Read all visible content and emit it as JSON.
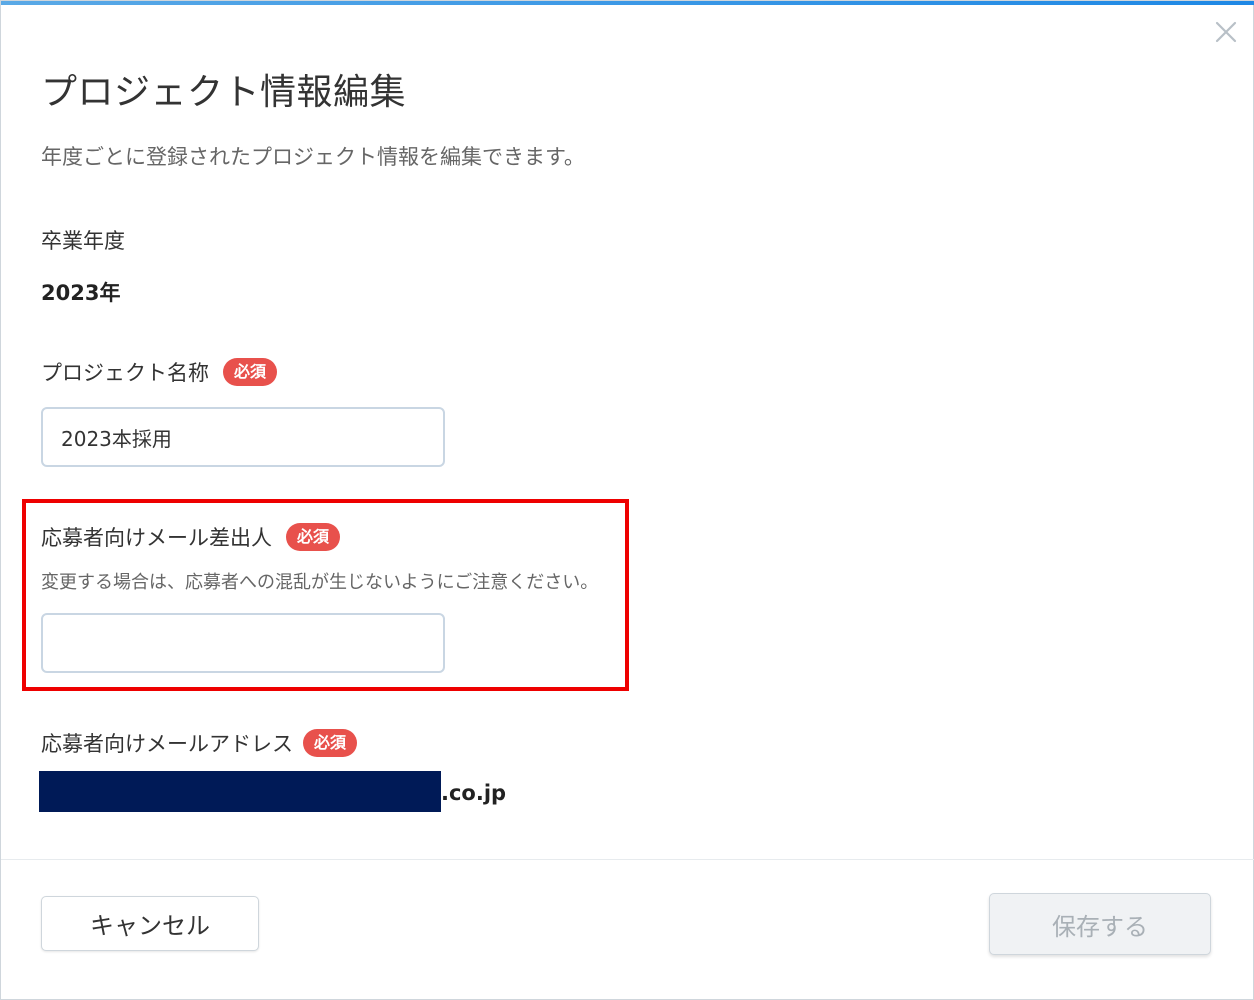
{
  "dialog": {
    "title": "プロジェクト情報編集",
    "description": "年度ごとに登録されたプロジェクト情報を編集できます。",
    "accent_color": "#1e88e5",
    "close_icon": "close-icon"
  },
  "required_badge": {
    "label": "必須",
    "color": "#e8514c"
  },
  "graduation_year": {
    "label": "卒業年度",
    "value": "2023年"
  },
  "project_name": {
    "label": "プロジェクト名称",
    "value": "2023本採用",
    "placeholder": ""
  },
  "sender_name": {
    "label": "応募者向けメール差出人",
    "hint": "変更する場合は、応募者への混乱が生じないようにご注意ください。",
    "value": "",
    "placeholder": ""
  },
  "sender_email": {
    "label": "応募者向けメールアドレス",
    "domain_suffix": ".co.jp",
    "redaction_color": "#001a57"
  },
  "highlight_color": "#ee0000",
  "buttons": {
    "cancel": "キャンセル",
    "save": "保存する",
    "save_disabled": true
  }
}
